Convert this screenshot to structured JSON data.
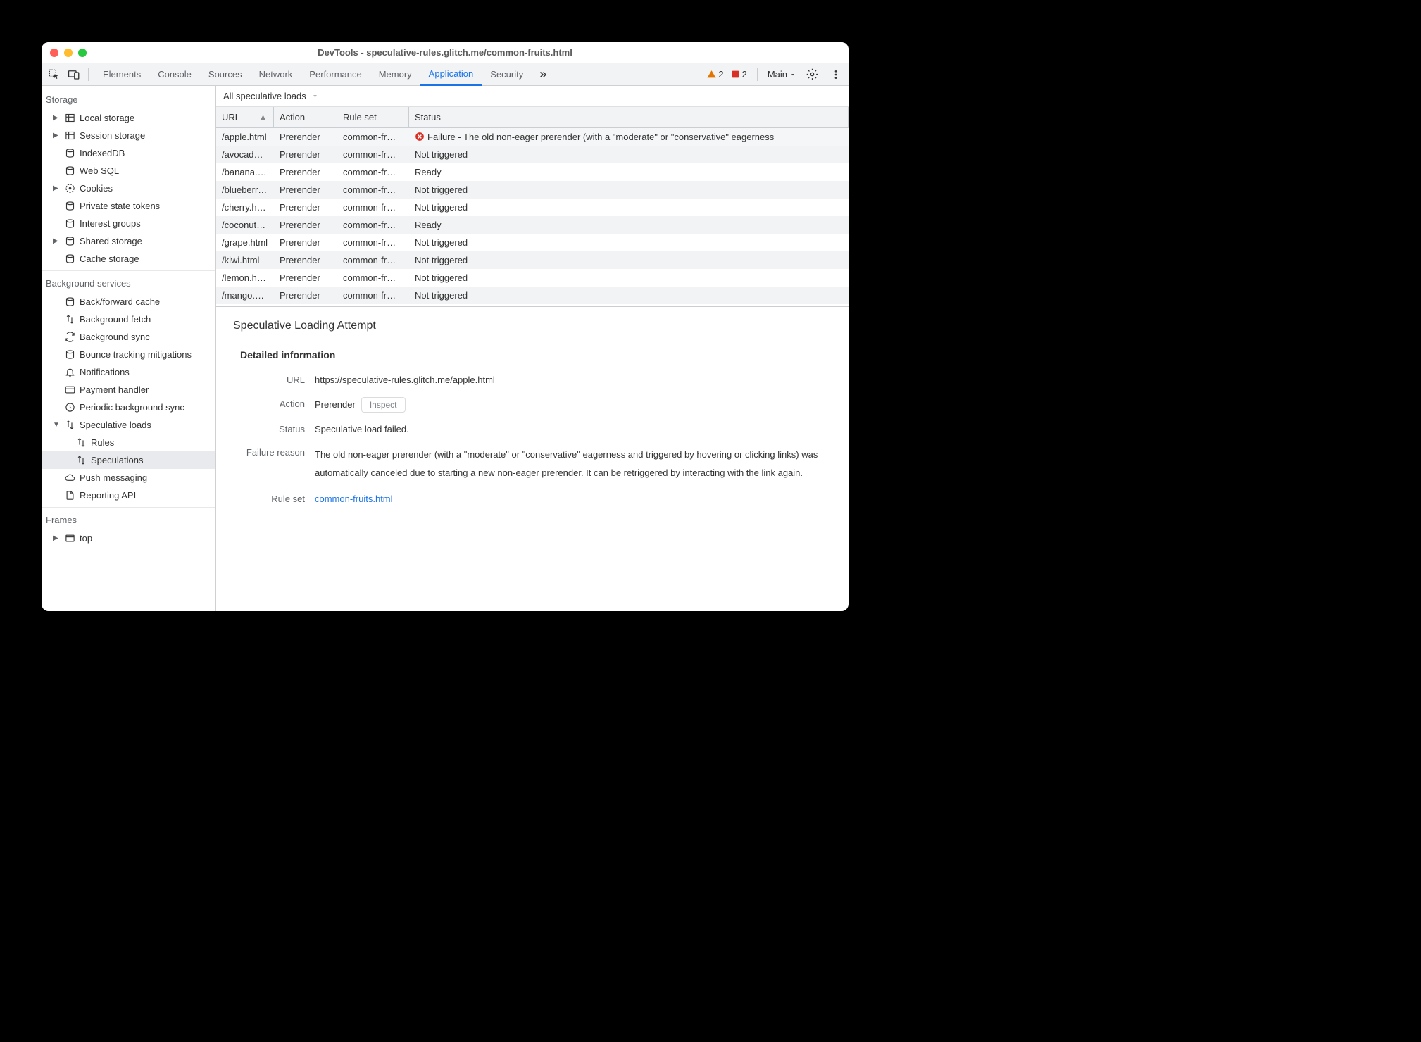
{
  "window_title": "DevTools - speculative-rules.glitch.me/common-fruits.html",
  "tabs": [
    "Elements",
    "Console",
    "Sources",
    "Network",
    "Performance",
    "Memory",
    "Application",
    "Security"
  ],
  "active_tab": "Application",
  "warnings": "2",
  "errors": "2",
  "main_label": "Main",
  "sidebar": {
    "storage": {
      "title": "Storage",
      "items": [
        {
          "label": "Local storage",
          "icon": "table",
          "expand": true
        },
        {
          "label": "Session storage",
          "icon": "table",
          "expand": true
        },
        {
          "label": "IndexedDB",
          "icon": "db"
        },
        {
          "label": "Web SQL",
          "icon": "db"
        },
        {
          "label": "Cookies",
          "icon": "cookie",
          "expand": true
        },
        {
          "label": "Private state tokens",
          "icon": "db"
        },
        {
          "label": "Interest groups",
          "icon": "db"
        },
        {
          "label": "Shared storage",
          "icon": "db",
          "expand": true
        },
        {
          "label": "Cache storage",
          "icon": "db"
        }
      ]
    },
    "bg": {
      "title": "Background services",
      "items": [
        {
          "label": "Back/forward cache",
          "icon": "db"
        },
        {
          "label": "Background fetch",
          "icon": "arrows"
        },
        {
          "label": "Background sync",
          "icon": "sync"
        },
        {
          "label": "Bounce tracking mitigations",
          "icon": "db"
        },
        {
          "label": "Notifications",
          "icon": "bell"
        },
        {
          "label": "Payment handler",
          "icon": "card"
        },
        {
          "label": "Periodic background sync",
          "icon": "clock"
        },
        {
          "label": "Speculative loads",
          "icon": "arrows",
          "expand": true,
          "open": true
        },
        {
          "label": "Rules",
          "icon": "arrows",
          "sub": true
        },
        {
          "label": "Speculations",
          "icon": "arrows",
          "sub": true,
          "selected": true
        },
        {
          "label": "Push messaging",
          "icon": "cloud"
        },
        {
          "label": "Reporting API",
          "icon": "doc"
        }
      ]
    },
    "frames": {
      "title": "Frames",
      "item": {
        "label": "top",
        "icon": "window",
        "expand": true
      }
    }
  },
  "filter": "All speculative loads",
  "columns": [
    "URL",
    "Action",
    "Rule set",
    "Status"
  ],
  "rows": [
    {
      "url": "/apple.html",
      "action": "Prerender",
      "rule": "common-fr…",
      "status": "Failure - The old non-eager prerender (with a \"moderate\" or \"conservative\" eagerness",
      "fail": true
    },
    {
      "url": "/avocad…",
      "action": "Prerender",
      "rule": "common-fr…",
      "status": "Not triggered"
    },
    {
      "url": "/banana.…",
      "action": "Prerender",
      "rule": "common-fr…",
      "status": "Ready"
    },
    {
      "url": "/blueberr…",
      "action": "Prerender",
      "rule": "common-fr…",
      "status": "Not triggered"
    },
    {
      "url": "/cherry.h…",
      "action": "Prerender",
      "rule": "common-fr…",
      "status": "Not triggered"
    },
    {
      "url": "/coconut…",
      "action": "Prerender",
      "rule": "common-fr…",
      "status": "Ready"
    },
    {
      "url": "/grape.html",
      "action": "Prerender",
      "rule": "common-fr…",
      "status": "Not triggered"
    },
    {
      "url": "/kiwi.html",
      "action": "Prerender",
      "rule": "common-fr…",
      "status": "Not triggered"
    },
    {
      "url": "/lemon.h…",
      "action": "Prerender",
      "rule": "common-fr…",
      "status": "Not triggered"
    },
    {
      "url": "/mango.…",
      "action": "Prerender",
      "rule": "common-fr…",
      "status": "Not triggered"
    }
  ],
  "detail": {
    "title": "Speculative Loading Attempt",
    "section": "Detailed information",
    "url_label": "URL",
    "url": "https://speculative-rules.glitch.me/apple.html",
    "action_label": "Action",
    "action": "Prerender",
    "inspect": "Inspect",
    "status_label": "Status",
    "status": "Speculative load failed.",
    "reason_label": "Failure reason",
    "reason": "The old non-eager prerender (with a \"moderate\" or \"conservative\" eagerness and triggered by hovering or clicking links) was automatically canceled due to starting a new non-eager prerender. It can be retriggered by interacting with the link again.",
    "ruleset_label": "Rule set",
    "ruleset": "common-fruits.html"
  }
}
